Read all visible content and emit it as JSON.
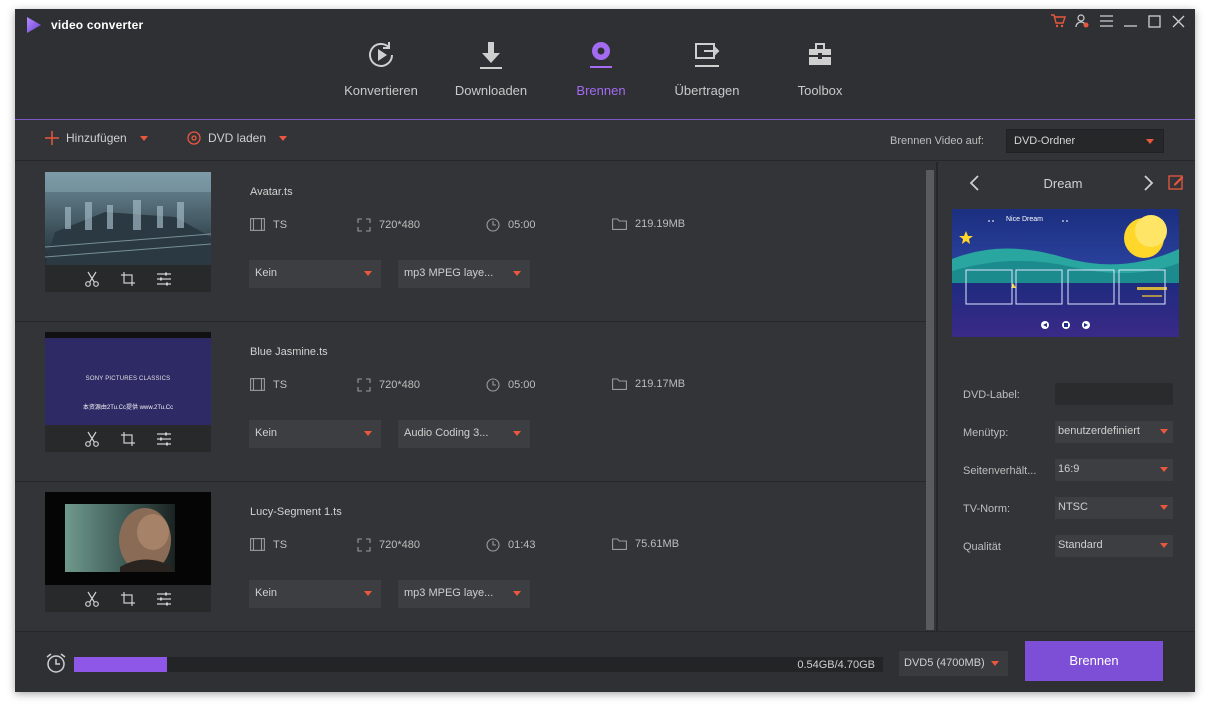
{
  "app": {
    "title": "video converter"
  },
  "nav": {
    "items": [
      {
        "label": "Konvertieren",
        "icon": "convert-play-icon"
      },
      {
        "label": "Downloaden",
        "icon": "download-icon"
      },
      {
        "label": "Brennen",
        "icon": "burn-disc-icon",
        "active": true
      },
      {
        "label": "Übertragen",
        "icon": "transfer-icon"
      },
      {
        "label": "Toolbox",
        "icon": "toolbox-icon"
      }
    ]
  },
  "toolbar": {
    "add_label": "Hinzufügen",
    "load_dvd_label": "DVD laden",
    "burn_to_label": "Brennen Video auf:",
    "burn_to_value": "DVD-Ordner"
  },
  "files": [
    {
      "name": "Avatar.ts",
      "format": "TS",
      "resolution": "720*480",
      "duration": "05:00",
      "size": "219.19MB",
      "subtitle": "Kein",
      "audio": "mp3 MPEG laye..."
    },
    {
      "name": "Blue Jasmine.ts",
      "format": "TS",
      "resolution": "720*480",
      "duration": "05:00",
      "size": "219.17MB",
      "subtitle": "Kein",
      "audio": "Audio Coding 3..."
    },
    {
      "name": "Lucy-Segment 1.ts",
      "format": "TS",
      "resolution": "720*480",
      "duration": "01:43",
      "size": "75.61MB",
      "subtitle": "Kein",
      "audio": "mp3 MPEG laye..."
    }
  ],
  "thumbs": {
    "sony_text": "SONY PICTURES CLASSICS",
    "sub_text": "本资源由2Tu.Cc提供 www.2Tu.Cc"
  },
  "template": {
    "name": "Dream",
    "preview_title": "Nice Dream",
    "fields": [
      {
        "label": "DVD-Label:",
        "value": "",
        "type": "input"
      },
      {
        "label": "Menütyp:",
        "value": "benutzerdefiniert",
        "type": "select"
      },
      {
        "label": "Seitenverhält...",
        "value": "16:9",
        "type": "select"
      },
      {
        "label": "TV-Norm:",
        "value": "NTSC",
        "type": "select"
      },
      {
        "label": "Qualität",
        "value": "Standard",
        "type": "select"
      }
    ]
  },
  "footer": {
    "capacity_text": "0.54GB/4.70GB",
    "capacity_fraction": 0.115,
    "disc_type": "DVD5 (4700MB)",
    "burn_label": "Brennen"
  },
  "colors": {
    "accent": "#9e67f0",
    "caret": "#e9573f",
    "button": "#7d4fd6"
  }
}
